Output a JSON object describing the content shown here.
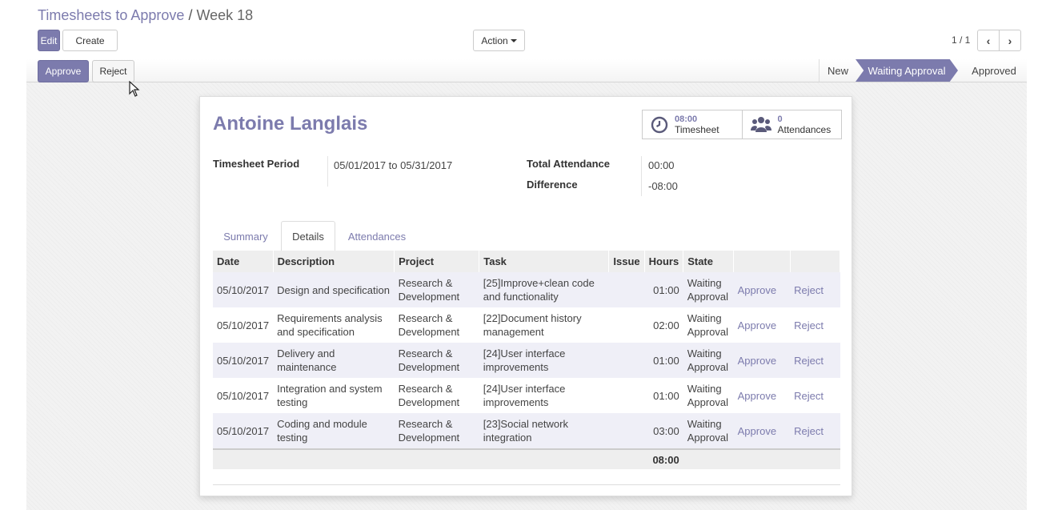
{
  "breadcrumb": {
    "parent": "Timesheets to Approve",
    "separator": "/",
    "current": "Week 18"
  },
  "toolbar": {
    "edit": "Edit",
    "create": "Create",
    "action": "Action"
  },
  "pager": {
    "value": "1 / 1"
  },
  "statusbar": {
    "approve": "Approve",
    "reject": "Reject",
    "stages": [
      "New",
      "Waiting Approval",
      "Approved"
    ],
    "active_stage": "Waiting Approval"
  },
  "sheet": {
    "employee": "Antoine Langlais",
    "smart_buttons": [
      {
        "value": "08:00",
        "label": "Timesheet",
        "icon": "clock-icon"
      },
      {
        "value": "0",
        "label": "Attendances",
        "icon": "users-icon"
      }
    ],
    "fields": {
      "period_label": "Timesheet Period",
      "period_value": "05/01/2017 to 05/31/2017",
      "total_label": "Total Attendance",
      "total_value": "00:00",
      "diff_label": "Difference",
      "diff_value": "-08:00"
    },
    "tabs": [
      "Summary",
      "Details",
      "Attendances"
    ],
    "active_tab": "Details",
    "columns": [
      "Date",
      "Description",
      "Project",
      "Task",
      "Issue",
      "Hours",
      "State",
      "",
      ""
    ],
    "rows": [
      {
        "date": "05/10/2017",
        "description": "Design and specification",
        "project": "Research & Development",
        "task": "[25]Improve+clean code and functionality",
        "issue": "",
        "hours": "01:00",
        "state": "Waiting Approval",
        "approve": "Approve",
        "reject": "Reject"
      },
      {
        "date": "05/10/2017",
        "description": "Requirements analysis and specification",
        "project": "Research & Development",
        "task": "[22]Document history management",
        "issue": "",
        "hours": "02:00",
        "state": "Waiting Approval",
        "approve": "Approve",
        "reject": "Reject"
      },
      {
        "date": "05/10/2017",
        "description": "Delivery and maintenance",
        "project": "Research & Development",
        "task": "[24]User interface improvements",
        "issue": "",
        "hours": "01:00",
        "state": "Waiting Approval",
        "approve": "Approve",
        "reject": "Reject"
      },
      {
        "date": "05/10/2017",
        "description": "Integration and system testing",
        "project": "Research & Development",
        "task": "[24]User interface improvements",
        "issue": "",
        "hours": "01:00",
        "state": "Waiting Approval",
        "approve": "Approve",
        "reject": "Reject"
      },
      {
        "date": "05/10/2017",
        "description": "Coding and module testing",
        "project": "Research & Development",
        "task": "[23]Social network integration",
        "issue": "",
        "hours": "03:00",
        "state": "Waiting Approval",
        "approve": "Approve",
        "reject": "Reject"
      }
    ],
    "total_hours": "08:00"
  },
  "colors": {
    "accent": "#7c7bad",
    "odd_row": "#efeff7",
    "header_row": "#eeeeee"
  }
}
